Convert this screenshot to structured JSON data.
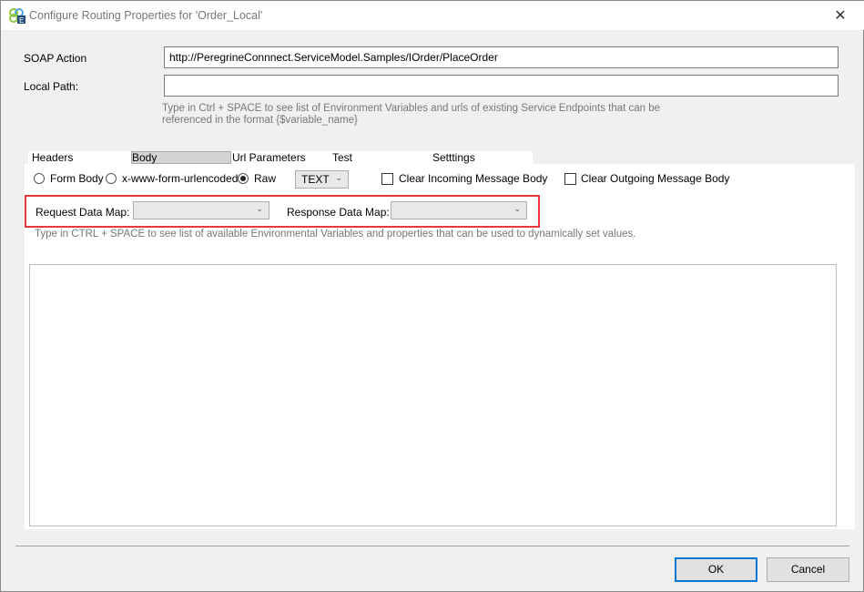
{
  "window": {
    "title": "Configure Routing Properties for 'Order_Local'",
    "close": "✕"
  },
  "form": {
    "soap_action_label": "SOAP Action",
    "soap_action_value": "http://PeregrineConnnect.ServiceModel.Samples/IOrder/PlaceOrder",
    "local_path_label": "Local Path:",
    "local_path_value": "",
    "hint_line1": "Type in Ctrl + SPACE to see list of Environment Variables and urls of existing Service Endpoints that can be",
    "hint_line2": "referenced in the format {$variable_name}"
  },
  "tabs": [
    {
      "label": "Headers"
    },
    {
      "label": "Body",
      "selected": true
    },
    {
      "label": "Url Parameters"
    },
    {
      "label": "Test"
    },
    {
      "label": "Setttings"
    }
  ],
  "body": {
    "radio_form": "Form Body",
    "radio_urlenc": "x-www-form-urlencoded",
    "radio_raw": "Raw",
    "selected_radio": "Raw",
    "format_value": "TEXT",
    "clear_incoming": "Clear Incoming Message Body",
    "clear_outgoing": "Clear Outgoing Message Body",
    "request_map_label": "Request Data Map:",
    "request_map_value": "",
    "response_map_label": "Response Data Map:",
    "response_map_value": "",
    "hint": "Type in CTRL + SPACE to see list of available Environmental Variables and properties that can be used to dynamically set values."
  },
  "buttons": {
    "ok": "OK",
    "cancel": "Cancel"
  },
  "colors": {
    "highlight": "#e8383d",
    "primary_border": "#0078d7"
  }
}
